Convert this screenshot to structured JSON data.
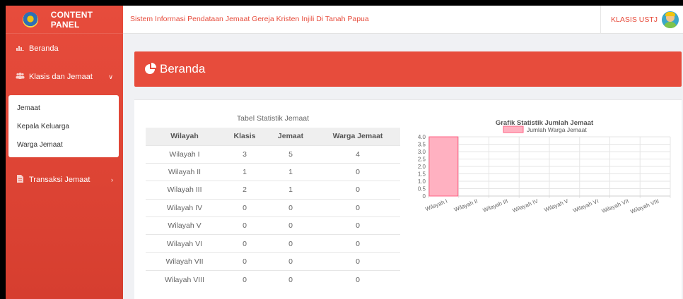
{
  "brand": {
    "title": "CONTENT PANEL"
  },
  "topbar": {
    "system_title": "Sistem Informasi Pendataan Jemaat Gereja Kristen Injili Di Tanah Papua",
    "user_name": "KLASIS USTJ"
  },
  "sidebar": {
    "items": [
      {
        "label": "Beranda",
        "icon": "chart-icon"
      },
      {
        "label": "Klasis dan Jemaat",
        "icon": "users-icon"
      },
      {
        "label": "Transaksi Jemaat",
        "icon": "file-icon"
      }
    ],
    "submenu": [
      "Jemaat",
      "Kepala Keluarga",
      "Warga Jemaat"
    ]
  },
  "page_header": {
    "title": "Beranda",
    "icon": "pie-chart-icon"
  },
  "table": {
    "title": "Tabel Statistik Jemaat",
    "headers": [
      "Wilayah",
      "Klasis",
      "Jemaat",
      "Warga Jemaat"
    ],
    "rows": [
      [
        "Wilayah I",
        "3",
        "5",
        "4"
      ],
      [
        "Wilayah II",
        "1",
        "1",
        "0"
      ],
      [
        "Wilayah III",
        "2",
        "1",
        "0"
      ],
      [
        "Wilayah IV",
        "0",
        "0",
        "0"
      ],
      [
        "Wilayah V",
        "0",
        "0",
        "0"
      ],
      [
        "Wilayah VI",
        "0",
        "0",
        "0"
      ],
      [
        "Wilayah VII",
        "0",
        "0",
        "0"
      ],
      [
        "Wilayah VIII",
        "0",
        "0",
        "0"
      ]
    ]
  },
  "chart_data": {
    "type": "bar",
    "title": "Grafik Statistik Jumlah Jemaat",
    "categories": [
      "Wilayah I",
      "Wilayah II",
      "Wilayah III",
      "Wilayah IV",
      "Wilayah V",
      "Wilayah VI",
      "Wilayah VII",
      "Wilayah VIII"
    ],
    "series": [
      {
        "name": "Jumlah Warga Jemaat",
        "values": [
          4,
          0,
          0,
          0,
          0,
          0,
          0,
          0
        ]
      }
    ],
    "ylim": [
      0,
      4
    ],
    "yticks": [
      "0",
      "0.5",
      "1.0",
      "1.5",
      "2.0",
      "2.5",
      "3.0",
      "3.5",
      "4.0"
    ],
    "grid": true,
    "legend": "top",
    "colors": {
      "bar_fill": "#ffb1c1",
      "bar_stroke": "#ff6384"
    }
  },
  "colors": {
    "accent": "#e74c3c"
  }
}
